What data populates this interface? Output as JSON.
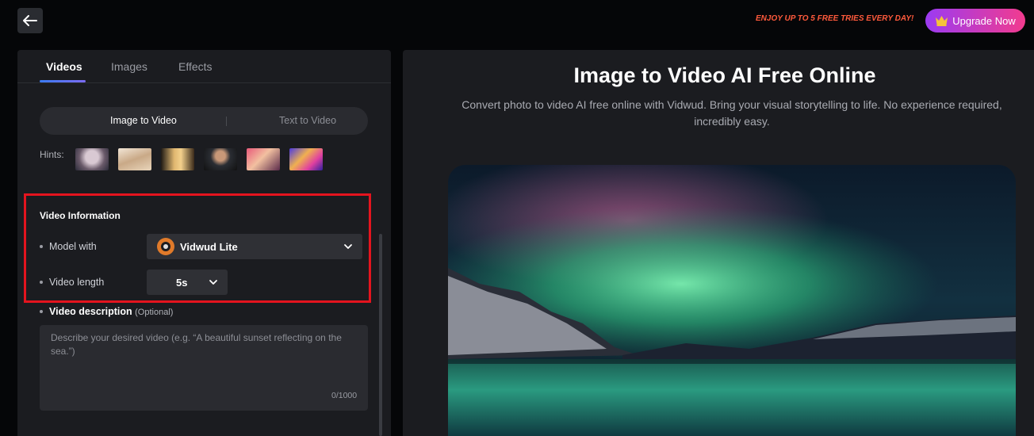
{
  "header": {
    "promo_text": "ENJOY UP TO 5 FREE TRIES EVERY DAY!",
    "upgrade_label": "Upgrade Now"
  },
  "tabs": [
    {
      "label": "Videos",
      "active": true
    },
    {
      "label": "Images",
      "active": false
    },
    {
      "label": "Effects",
      "active": false
    }
  ],
  "modes": {
    "active": "Image to Video",
    "inactive": "Text to Video"
  },
  "hints": {
    "label": "Hints:"
  },
  "video_info": {
    "title": "Video Information",
    "model_label": "Model with",
    "model_value": "Vidwud Lite",
    "length_label": "Video length",
    "length_value": "5s"
  },
  "description": {
    "label": "Video description",
    "optional": "(Optional)",
    "placeholder": "Describe your desired video (e.g. “A beautiful sunset reflecting on the sea.”)",
    "counter": "0/1000"
  },
  "hero": {
    "title": "Image to Video AI Free Online",
    "subtitle": "Convert photo to video AI free online with Vidwud. Bring your visual storytelling to life. No experience required, incredibly easy."
  },
  "colors": {
    "accent_red": "#e4141e",
    "promo": "#ff5a3c",
    "upgrade_start": "#9b3bf2",
    "upgrade_end": "#f23b8e"
  }
}
